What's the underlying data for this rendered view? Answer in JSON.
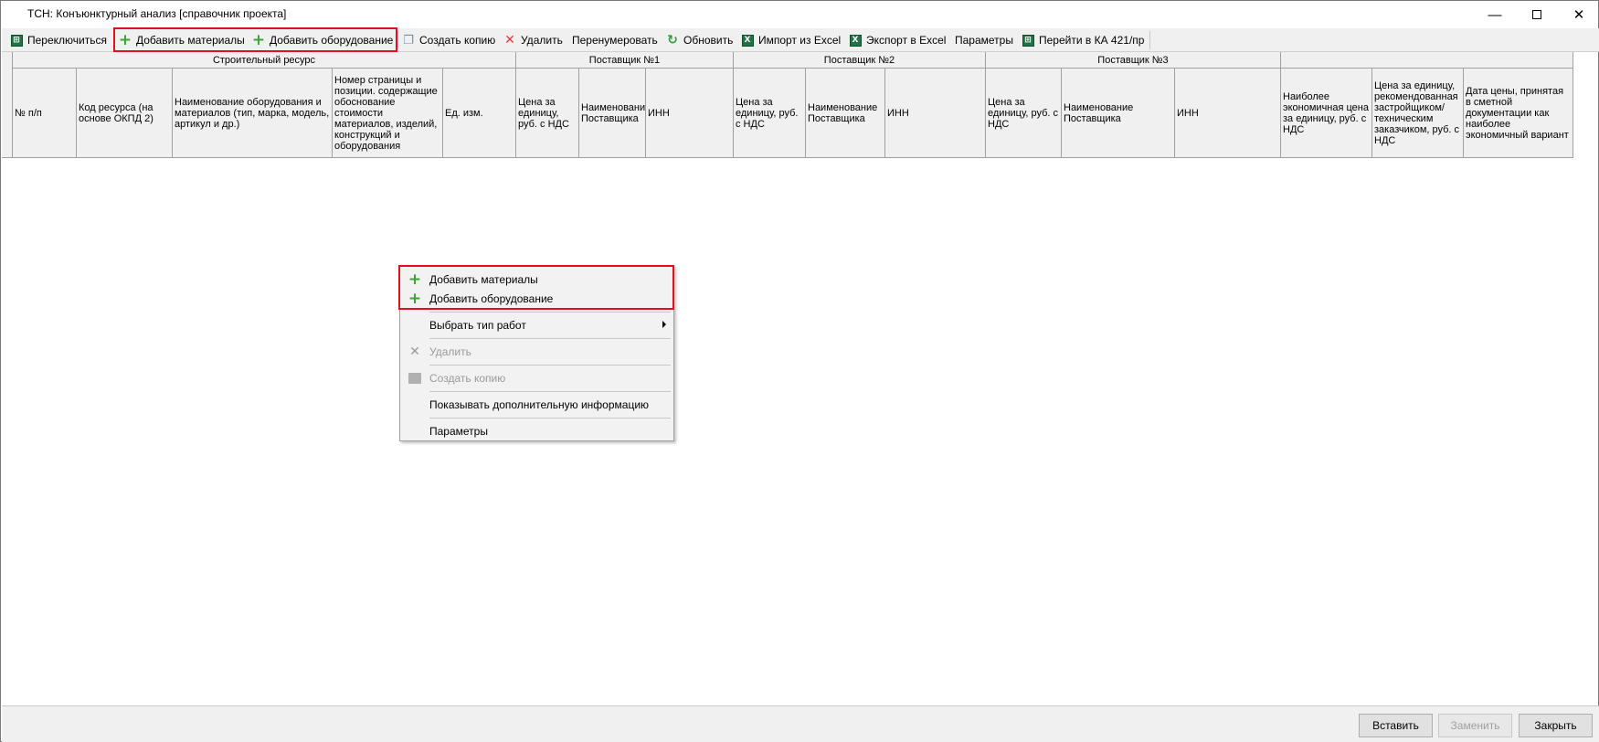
{
  "window": {
    "title": "ТСН: Конъюнктурный анализ [справочник проекта]",
    "minimize_symbol": "—",
    "close_symbol": "✕"
  },
  "toolbar": {
    "switch": "Переключиться",
    "add_materials": "Добавить материалы",
    "add_equipment": "Добавить оборудование",
    "create_copy": "Создать копию",
    "delete": "Удалить",
    "renumber": "Перенумеровать",
    "refresh": "Обновить",
    "import_excel": "Импорт из Excel",
    "export_excel": "Экспорт в Excel",
    "parameters": "Параметры",
    "goto_ka": "Перейти в КА 421/пр"
  },
  "grid": {
    "groups": {
      "resource": "Строительный ресурс",
      "supplier1": "Поставщик №1",
      "supplier2": "Поставщик №2",
      "supplier3": "Поставщик №3"
    },
    "columns": [
      "№ п/п",
      "Код ресурса (на основе ОКПД 2)",
      "Наименование оборудования и материалов (тип, марка, модель, артикул и др.)",
      "Номер страницы и позиции. содержащие обоснование стоимости материалов, изделий, конструкций и оборудования",
      "Ед. изм.",
      "Цена за единицу, руб. с НДС",
      "Наименование Поставщика",
      "ИНН",
      "Цена за единицу, руб. с НДС",
      "Наименование Поставщика",
      "ИНН",
      "Цена за единицу, руб. с НДС",
      "Наименование Поставщика",
      "ИНН",
      "Наиболее экономичная цена за единицу, руб. с НДС",
      "Цена за единицу, рекомендованная застройщиком/ техническим заказчиком, руб. с НДС",
      "Дата цены, принятая в сметной документации как наиболее экономичный вариант"
    ]
  },
  "context_menu": {
    "add_materials": "Добавить материалы",
    "add_equipment": "Добавить оборудование",
    "select_work_type": "Выбрать тип работ",
    "delete": "Удалить",
    "create_copy": "Создать копию",
    "show_more_info": "Показывать дополнительную информацию",
    "parameters": "Параметры"
  },
  "buttons": {
    "insert": "Вставить",
    "replace": "Заменить",
    "close": "Закрыть"
  },
  "colors": {
    "highlight": "#e0101e",
    "plus_icon": "#3aa532",
    "excel_icon": "#217346",
    "delete_icon": "#e53935"
  }
}
